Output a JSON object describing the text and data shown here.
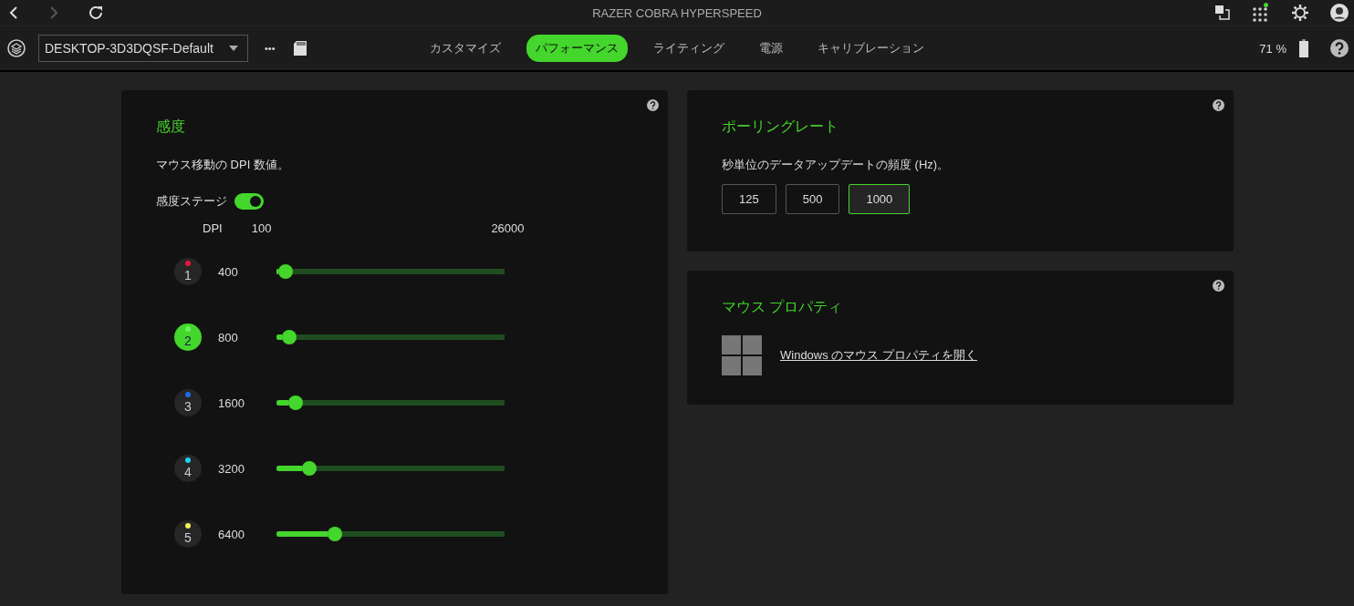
{
  "window": {
    "title": "RAZER COBRA HYPERSPEED"
  },
  "toolbar": {
    "profile": "DESKTOP-3D3DQSF-Default",
    "more": "•••",
    "battery": "71 %"
  },
  "tabs": [
    {
      "label": "カスタマイズ",
      "selected": false
    },
    {
      "label": "パフォーマンス",
      "selected": true
    },
    {
      "label": "ライティング",
      "selected": false
    },
    {
      "label": "電源",
      "selected": false
    },
    {
      "label": "キャリブレーション",
      "selected": false
    }
  ],
  "sensitivity": {
    "title": "感度",
    "description": "マウス移動の DPI 数値。",
    "stages_label": "感度ステージ",
    "stages_on": true,
    "header_dpi": "DPI",
    "min": "100",
    "max": "26000",
    "stages": [
      {
        "number": "1",
        "color": "#e8173a",
        "selected": false,
        "value": "400",
        "level": 0.04
      },
      {
        "number": "2",
        "color": "#6cf05a",
        "selected": true,
        "value": "800",
        "level": 0.056
      },
      {
        "number": "3",
        "color": "#1a6fe0",
        "selected": false,
        "value": "1600",
        "level": 0.084
      },
      {
        "number": "4",
        "color": "#19d3f0",
        "selected": false,
        "value": "3200",
        "level": 0.144
      },
      {
        "number": "5",
        "color": "#f5f05a",
        "selected": false,
        "value": "6400",
        "level": 0.256
      }
    ]
  },
  "polling_rate": {
    "title": "ポーリングレート",
    "description": "秒単位のデータアップデートの頻度 (Hz)。",
    "options": [
      {
        "label": "125",
        "selected": false
      },
      {
        "label": "500",
        "selected": false
      },
      {
        "label": "1000",
        "selected": true
      }
    ]
  },
  "mouse_properties": {
    "title": "マウス プロパティ",
    "link": "Windows のマウス プロパティを開く"
  }
}
